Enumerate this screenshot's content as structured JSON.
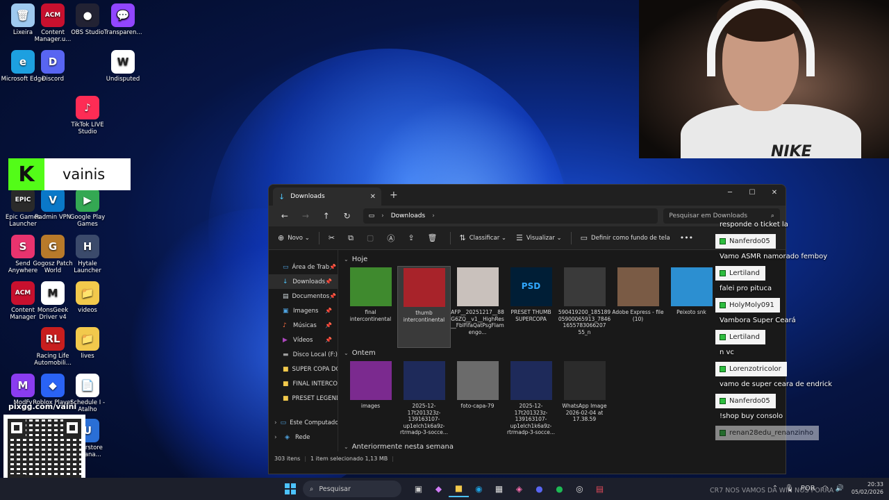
{
  "desktop_icons": [
    {
      "label": "Lixeira",
      "icon": "recycle-bin-icon",
      "color": "#9ec9ef",
      "glyph": "🗑"
    },
    {
      "label": "Content Manager.u...",
      "icon": "content-manager-icon",
      "color": "#c8102e",
      "glyph": "ACM"
    },
    {
      "label": "OBS Studio",
      "icon": "obs-icon",
      "color": "#222233",
      "glyph": "●"
    },
    {
      "label": "Transparen...",
      "icon": "chat-bubble-icon",
      "color": "#9146ff",
      "glyph": "💬"
    },
    {
      "label": "Microsoft Edge",
      "icon": "edge-icon",
      "color": "#1da0e0",
      "glyph": "e"
    },
    {
      "label": "Discord",
      "icon": "discord-icon",
      "color": "#5865f2",
      "glyph": "D"
    },
    {
      "label": "Undisputed",
      "icon": "undisputed-icon",
      "color": "#ffffff",
      "glyph": "W"
    },
    {
      "label": "TikTok LIVE Studio",
      "icon": "tiktok-icon",
      "color": "#fe2c55",
      "glyph": "♪"
    },
    {
      "label": "Epic Games Launcher",
      "icon": "epic-icon",
      "color": "#2a2a2a",
      "glyph": "EPIC"
    },
    {
      "label": "Radmin VPN",
      "icon": "radmin-icon",
      "color": "#0a78c8",
      "glyph": "V"
    },
    {
      "label": "Google Play Games",
      "icon": "play-games-icon",
      "color": "#34a853",
      "glyph": "▶"
    },
    {
      "label": "Send Anywhere",
      "icon": "send-anywhere-icon",
      "color": "#e8336e",
      "glyph": "S"
    },
    {
      "label": "Gogosz Patch World",
      "icon": "game-icon",
      "color": "#b87a2a",
      "glyph": "G"
    },
    {
      "label": "Hytale Launcher",
      "icon": "hytale-icon",
      "color": "#3b4a6b",
      "glyph": "H"
    },
    {
      "label": "Content Manager",
      "icon": "content-manager-icon",
      "color": "#c8102e",
      "glyph": "ACM"
    },
    {
      "label": "MonsGeek Driver v4",
      "icon": "monsgeek-icon",
      "color": "#ffffff",
      "glyph": "M"
    },
    {
      "label": "videos",
      "icon": "folder-icon",
      "color": "#f2c94c",
      "glyph": "📁"
    },
    {
      "label": "Racing Life Automobili...",
      "icon": "racing-life-icon",
      "color": "#c81e1e",
      "glyph": "RL"
    },
    {
      "label": "lives",
      "icon": "folder-icon",
      "color": "#f2c94c",
      "glyph": "📁"
    },
    {
      "label": "ModFy",
      "icon": "modfy-icon",
      "color": "#8a3cf0",
      "glyph": "M"
    },
    {
      "label": "Roblox Player",
      "icon": "roblox-icon",
      "color": "#2a63f5",
      "glyph": "◆"
    },
    {
      "label": "Schedule I - Atalho",
      "icon": "file-icon",
      "color": "#ffffff",
      "glyph": "📄"
    },
    {
      "label": "...derstore ...Mana...",
      "icon": "app-icon",
      "color": "#2a6fd6",
      "glyph": "U"
    }
  ],
  "kick_overlay": {
    "logo": "K",
    "name": "vainis"
  },
  "pix_text": "pixgg.com/vaini",
  "webcam": {
    "shirt_text": "NIKE"
  },
  "chat": {
    "first_message": "responde o ticket la",
    "items": [
      {
        "user": "Nanferdo05",
        "message": "Vamo ASMR namorado femboy"
      },
      {
        "user": "Lertiland",
        "message": "falei pro pituca"
      },
      {
        "user": "HolyMoly091",
        "message": "Vambora Super Ceará"
      },
      {
        "user": "Lertiland",
        "message": "n vc"
      },
      {
        "user": "Lorenzotricolor",
        "message": "vamo de super ceara de endrick"
      },
      {
        "user": "Nanferdo05",
        "message": "!shop buy consolo"
      }
    ],
    "last_user": "renan28edu_renanzinho"
  },
  "explorer": {
    "tab_title": "Downloads",
    "address": "Downloads",
    "search_placeholder": "Pesquisar em Downloads",
    "toolbar": {
      "new": "Novo",
      "sort": "Classificar",
      "view": "Visualizar",
      "set_wallpaper": "Definir como fundo de tela"
    },
    "sidebar": [
      {
        "label": "Área de Trab",
        "icon": "desktop-icon",
        "glyph": "▭",
        "color": "#4fa3e0",
        "pinned": true
      },
      {
        "label": "Downloads",
        "icon": "download-icon",
        "glyph": "↓",
        "color": "#4fc3f7",
        "pinned": true,
        "selected": true
      },
      {
        "label": "Documentos",
        "icon": "document-icon",
        "glyph": "▤",
        "color": "#cfd8dc",
        "pinned": true
      },
      {
        "label": "Imagens",
        "icon": "image-icon",
        "glyph": "▣",
        "color": "#4fa3e0",
        "pinned": true
      },
      {
        "label": "Músicas",
        "icon": "music-icon",
        "glyph": "♪",
        "color": "#ff7043",
        "pinned": true
      },
      {
        "label": "Vídeos",
        "icon": "video-icon",
        "glyph": "▶",
        "color": "#ab47bc",
        "pinned": true
      },
      {
        "label": "Disco Local (F:)",
        "icon": "drive-icon",
        "glyph": "▬",
        "color": "#9e9e9e",
        "pinned": false
      },
      {
        "label": "SUPER COPA DO",
        "icon": "folder-icon",
        "glyph": "■",
        "color": "#f2c94c",
        "pinned": false
      },
      {
        "label": "FINAL INTERCO",
        "icon": "folder-icon",
        "glyph": "■",
        "color": "#f2c94c",
        "pinned": false
      },
      {
        "label": "PRESET LEGEND",
        "icon": "folder-icon",
        "glyph": "■",
        "color": "#f2c94c",
        "pinned": false
      }
    ],
    "sidebar_bottom": [
      {
        "label": "Este Computador",
        "icon": "computer-icon",
        "glyph": "▭",
        "color": "#4fa3e0"
      },
      {
        "label": "Rede",
        "icon": "network-icon",
        "glyph": "◈",
        "color": "#4fa3e0"
      }
    ],
    "groups": [
      {
        "title": "Hoje",
        "items": [
          {
            "label": "final intercontinental",
            "thumb": "#3f8a2e",
            "glyph": "",
            "selected": false
          },
          {
            "label": "thumb intercontinental",
            "thumb": "#a8232a",
            "glyph": "",
            "selected": true
          },
          {
            "label": "AFP__20251217__88G6ZQ__v1__HighRes__FblFifaQatPsgFlamengo...",
            "thumb": "#c9c1bc",
            "glyph": "",
            "selected": false
          },
          {
            "label": "PRESET THUMB SUPERCOPA",
            "thumb": "#001e36",
            "glyph": "PSD",
            "selected": false
          },
          {
            "label": "590419200_18518905900065913_78461655783066207 55_n",
            "thumb": "#3a3a3a",
            "glyph": "",
            "selected": false
          },
          {
            "label": "Adobe Express - file (10)",
            "thumb": "#7a5b45",
            "glyph": "",
            "selected": false
          },
          {
            "label": "Peixoto snk",
            "thumb": "#2c8fd1",
            "glyph": "",
            "selected": false
          }
        ]
      },
      {
        "title": "Ontem",
        "items": [
          {
            "label": "images",
            "thumb": "#7b2a8f",
            "glyph": "",
            "selected": false
          },
          {
            "label": "2025-12-17t201323z-139163107-up1elch1k6a9z-rtrmadp-3-socce...",
            "thumb": "#1e2a5a",
            "glyph": "",
            "selected": false
          },
          {
            "label": "foto-capa-79",
            "thumb": "#6b6b6b",
            "glyph": "",
            "selected": false
          },
          {
            "label": "2025-12-17t201323z-139163107-up1elch1k6a9z-rtrmadp-3-socce...",
            "thumb": "#1e2a5a",
            "glyph": "",
            "selected": false
          },
          {
            "label": "WhatsApp Image 2026-02-04 at 17.38.59",
            "thumb": "#2b2b2b",
            "glyph": "",
            "selected": false
          }
        ]
      },
      {
        "title": "Anteriormente nesta semana",
        "items": []
      }
    ],
    "status": {
      "count": "303 itens",
      "selection": "1 item selecionado  1,13 MB"
    }
  },
  "taskbar": {
    "search_label": "Pesquisar",
    "lang": "POR",
    "time": "20:33",
    "date": "05/02/2026"
  },
  "ghost_text": "CR7 NOS VAMOS DA WIN NOS PORRA"
}
